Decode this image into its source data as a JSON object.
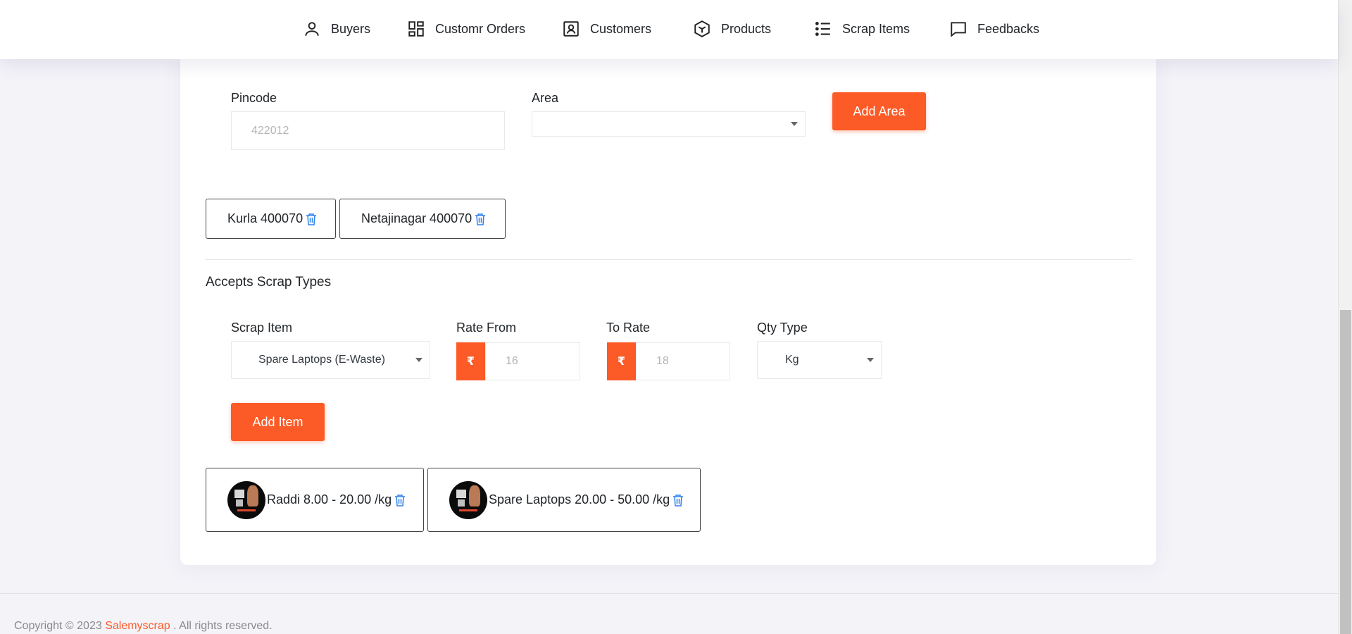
{
  "nav": {
    "buyers": "Buyers",
    "orders": "Customr Orders",
    "customers": "Customers",
    "products": "Products",
    "scrap_items": "Scrap Items",
    "feedbacks": "Feedbacks"
  },
  "area_form": {
    "pincode_label": "Pincode",
    "pincode_value": "422012",
    "area_label": "Area",
    "area_value": "",
    "add_area_label": "Add Area"
  },
  "areas": [
    {
      "name": "Kurla 400070"
    },
    {
      "name": "Netajinagar 400070"
    }
  ],
  "scrap_section": {
    "title": "Accepts Scrap Types",
    "scrap_item_label": "Scrap Item",
    "scrap_item_value": "Spare Laptops (E-Waste)",
    "rate_from_label": "Rate From",
    "rate_from_value": "16",
    "to_rate_label": "To Rate",
    "to_rate_value": "18",
    "currency_symbol": "₹",
    "qty_type_label": "Qty Type",
    "qty_type_value": "Kg",
    "add_item_label": "Add Item"
  },
  "items": [
    {
      "text": "Raddi 8.00 - 20.00 /kg"
    },
    {
      "text": "Spare Laptops 20.00 - 50.00 /kg"
    }
  ],
  "footer": {
    "prefix": "Copyright © 2023",
    "brand": "Salemyscrap",
    "suffix": ". All rights reserved."
  },
  "colors": {
    "accent": "#fc5a26",
    "icon_blue": "#2f80ed"
  }
}
